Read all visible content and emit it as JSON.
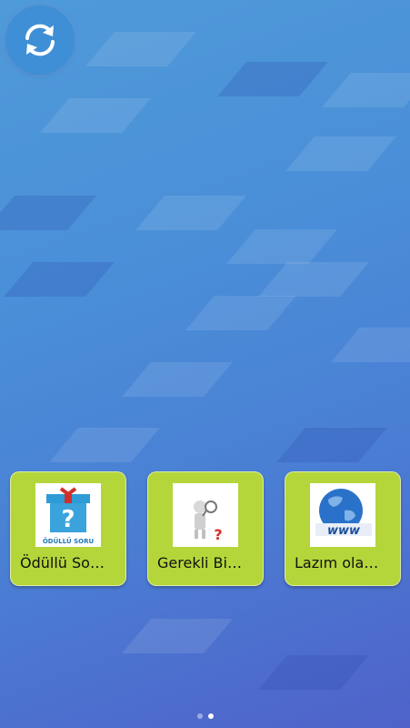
{
  "colors": {
    "tile": "#b4d63a",
    "refresh": "#3f8fd6",
    "background_top": "#4f9ad9",
    "background_bottom": "#4f62c9"
  },
  "toolbar": {
    "refresh_icon": "refresh-icon"
  },
  "tiles": [
    {
      "label": "Ödüllü So…",
      "icon": "gift-box-question-icon",
      "icon_caption": "ÖDÜLLÜ SORU"
    },
    {
      "label": "Gerekli Bi…",
      "icon": "figure-magnifier-question-icon"
    },
    {
      "label": "Lazım ola…",
      "icon": "globe-www-icon",
      "icon_caption": "www"
    }
  ],
  "pager": {
    "pages": 2,
    "current": 2
  }
}
